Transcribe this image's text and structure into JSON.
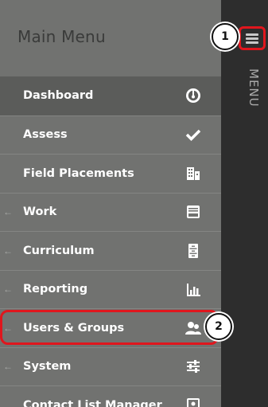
{
  "menu": {
    "title": "Main Menu",
    "items": [
      {
        "label": "Dashboard",
        "has_arrow": false,
        "icon": "dashboard-gauge-icon"
      },
      {
        "label": "Assess",
        "has_arrow": false,
        "icon": "checkmark-icon"
      },
      {
        "label": "Field Placements",
        "has_arrow": false,
        "icon": "building-icon"
      },
      {
        "label": "Work",
        "has_arrow": true,
        "icon": "inbox-tray-icon"
      },
      {
        "label": "Curriculum",
        "has_arrow": true,
        "icon": "file-cabinet-icon"
      },
      {
        "label": "Reporting",
        "has_arrow": true,
        "icon": "bar-chart-icon"
      },
      {
        "label": "Users & Groups",
        "has_arrow": true,
        "icon": "users-icon"
      },
      {
        "label": "System",
        "has_arrow": true,
        "icon": "sliders-icon"
      },
      {
        "label": "Contact List Manager",
        "has_arrow": false,
        "icon": "contact-card-icon"
      }
    ]
  },
  "rail": {
    "label": "MENU"
  },
  "callouts": {
    "one": "1",
    "two": "2"
  },
  "colors": {
    "highlight": "#e0161d",
    "panel": "#717270",
    "rail": "#2d2d2d"
  }
}
